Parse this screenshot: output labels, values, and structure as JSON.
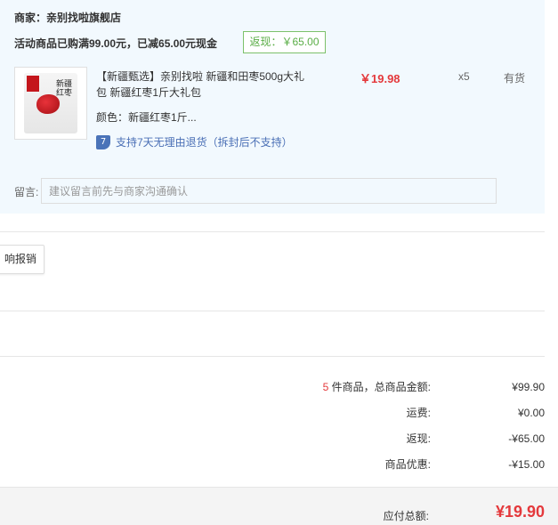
{
  "shop": {
    "label": "商家：",
    "name": "亲别找啦旗舰店",
    "promo_text": "活动商品已购满99.00元，已减65.00元现金",
    "rebate_badge": "返现：￥65.00"
  },
  "product": {
    "title": "【新疆甄选】亲别找啦 新疆和田枣500g大礼包 新疆红枣1斤大礼包",
    "spec": "颜色：新疆红枣1斤...",
    "bag_text": "新疆红枣",
    "return_icon": "7",
    "return_policy": "支持7天无理由退货（拆封后不支持）",
    "price": "￥19.98",
    "quantity": "x5",
    "stock": "有货",
    "accent_color": "#e4393c"
  },
  "note": {
    "label": "留言:",
    "placeholder": "建议留言前先与商家沟通确认"
  },
  "invoice": {
    "button_label": "响报销"
  },
  "summary": {
    "item_count": "5",
    "item_label": " 件商品，总商品金额:",
    "item_total": "¥99.90",
    "shipping_label": "运费:",
    "shipping": "¥0.00",
    "rebate_label": "返现:",
    "rebate": "-¥65.00",
    "discount_label": "商品优惠:",
    "discount": "-¥15.00",
    "payable_label": "应付总额:",
    "payable": "¥19.90"
  }
}
